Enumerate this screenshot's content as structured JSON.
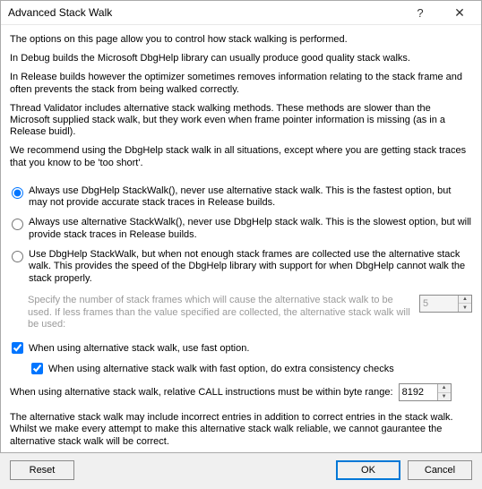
{
  "window": {
    "title": "Advanced Stack Walk"
  },
  "intro": {
    "p1": "The options on this page allow you to control how stack walking is performed.",
    "p2": "In Debug builds the Microsoft DbgHelp library can usually produce good quality stack walks.",
    "p3": "In Release builds however the optimizer sometimes removes information relating to the stack frame and often prevents the stack from being walked correctly.",
    "p4": "Thread Validator includes alternative stack walking methods. These methods are slower than the Microsoft supplied stack walk, but they work even when frame pointer information is missing (as in a Release buidl).",
    "p5": "We recommend using the DbgHelp stack walk in all situations, except where you are getting stack traces that you know to be 'too short'."
  },
  "radios": {
    "opt1": "Always use DbgHelp StackWalk(), never use alternative stack walk. This is the fastest option, but may not provide accurate stack traces in Release builds.",
    "opt2": "Always use alternative StackWalk(), never use DbgHelp stack walk. This is the slowest option, but will provide stack traces in Release builds.",
    "opt3": "Use DbgHelp StackWalk, but when not enough stack frames are collected use the alternative stack walk. This provides the speed of the DbgHelp library with support for when DbgHelp cannot walk the stack properly."
  },
  "framesSpec": {
    "text": "Specify the number of stack frames which will cause the alternative stack walk to be used. If less frames than the value specified are collected, the alternative stack walk will be used:",
    "value": "5"
  },
  "checks": {
    "fast": "When using alternative stack walk, use fast option.",
    "extra": "When using alternative stack walk with fast option, do extra consistency checks"
  },
  "byteRange": {
    "label": "When using alternative stack walk, relative CALL instructions must be within byte range:",
    "value": "8192"
  },
  "footer": {
    "note": "The alternative stack walk may include incorrect entries in addition to correct entries in the stack walk. Whilst we make every attempt to make this alternative stack walk reliable, we cannot gaurantee the alternative stack walk will be correct."
  },
  "buttons": {
    "reset": "Reset",
    "ok": "OK",
    "cancel": "Cancel"
  }
}
